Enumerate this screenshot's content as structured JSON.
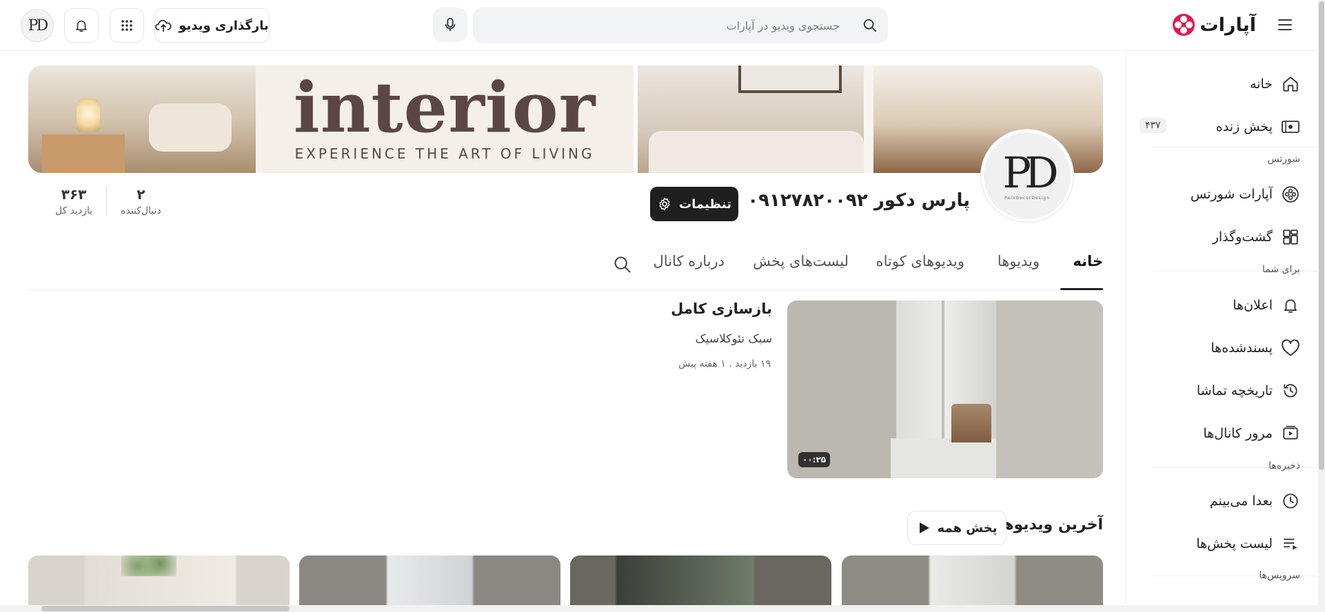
{
  "header": {
    "logo_text": "آپارات",
    "search_placeholder": "جستجوی ویدیو در آپارات",
    "upload_label": "بارگذاری ویدیو",
    "user_avatar_text": "PD"
  },
  "sidebar": {
    "items": [
      {
        "label": "خانه",
        "icon": "home-icon"
      },
      {
        "label": "پخش زنده",
        "icon": "live-icon",
        "badge": "۴۳۷"
      },
      {
        "label": "آپارات شورتس",
        "icon": "shorts-icon"
      },
      {
        "label": "گشت‌وگذار",
        "icon": "explore-icon"
      },
      {
        "label": "اعلان‌ها",
        "icon": "bell-icon"
      },
      {
        "label": "پسندشده‌ها",
        "icon": "heart-icon"
      },
      {
        "label": "تاریخچه تماشا",
        "icon": "history-icon"
      },
      {
        "label": "مرور کانال‌ها",
        "icon": "channels-icon"
      },
      {
        "label": "بعدا می‌بینم",
        "icon": "clock-icon"
      },
      {
        "label": "لیست پخش‌ها",
        "icon": "playlist-icon"
      }
    ],
    "sections": {
      "shorts": "شورتس",
      "for_you": "برای شما",
      "saved": "ذخیره‌ها",
      "services": "سرویس‌ها"
    }
  },
  "banner": {
    "title": "interior",
    "subtitle": "EXPERIENCE THE ART OF LIVING"
  },
  "channel": {
    "name": "پارس دکور ۰۹۱۲۷۸۲۰۰۹۲",
    "avatar_monogram": "PD",
    "avatar_tagline": "ParsDecorDesign",
    "settings_label": "تنظیمات",
    "stats": [
      {
        "value": "۳۶۳",
        "caption": "بازدید کل"
      },
      {
        "value": "۲",
        "caption": "دنبال‌کننده"
      }
    ]
  },
  "tabs": [
    "خانه",
    "ویدیوها",
    "ویدیوهای کوتاه",
    "لیست‌های پخش",
    "درباره کانال"
  ],
  "active_tab": "خانه",
  "featured": {
    "title": "بازسازی کامل",
    "description": "سبک نئوکلاسیک",
    "meta": "۱۹ بازدید . ۱ هفته پیش",
    "duration": "۰۰:۲۵"
  },
  "latest": {
    "title": "آخرین ویدیوها",
    "play_all_label": "پخش همه"
  },
  "colors": {
    "brand": "#df1a4f",
    "dark_button": "#1f1f1f",
    "search_bg": "#f2f3f5"
  }
}
